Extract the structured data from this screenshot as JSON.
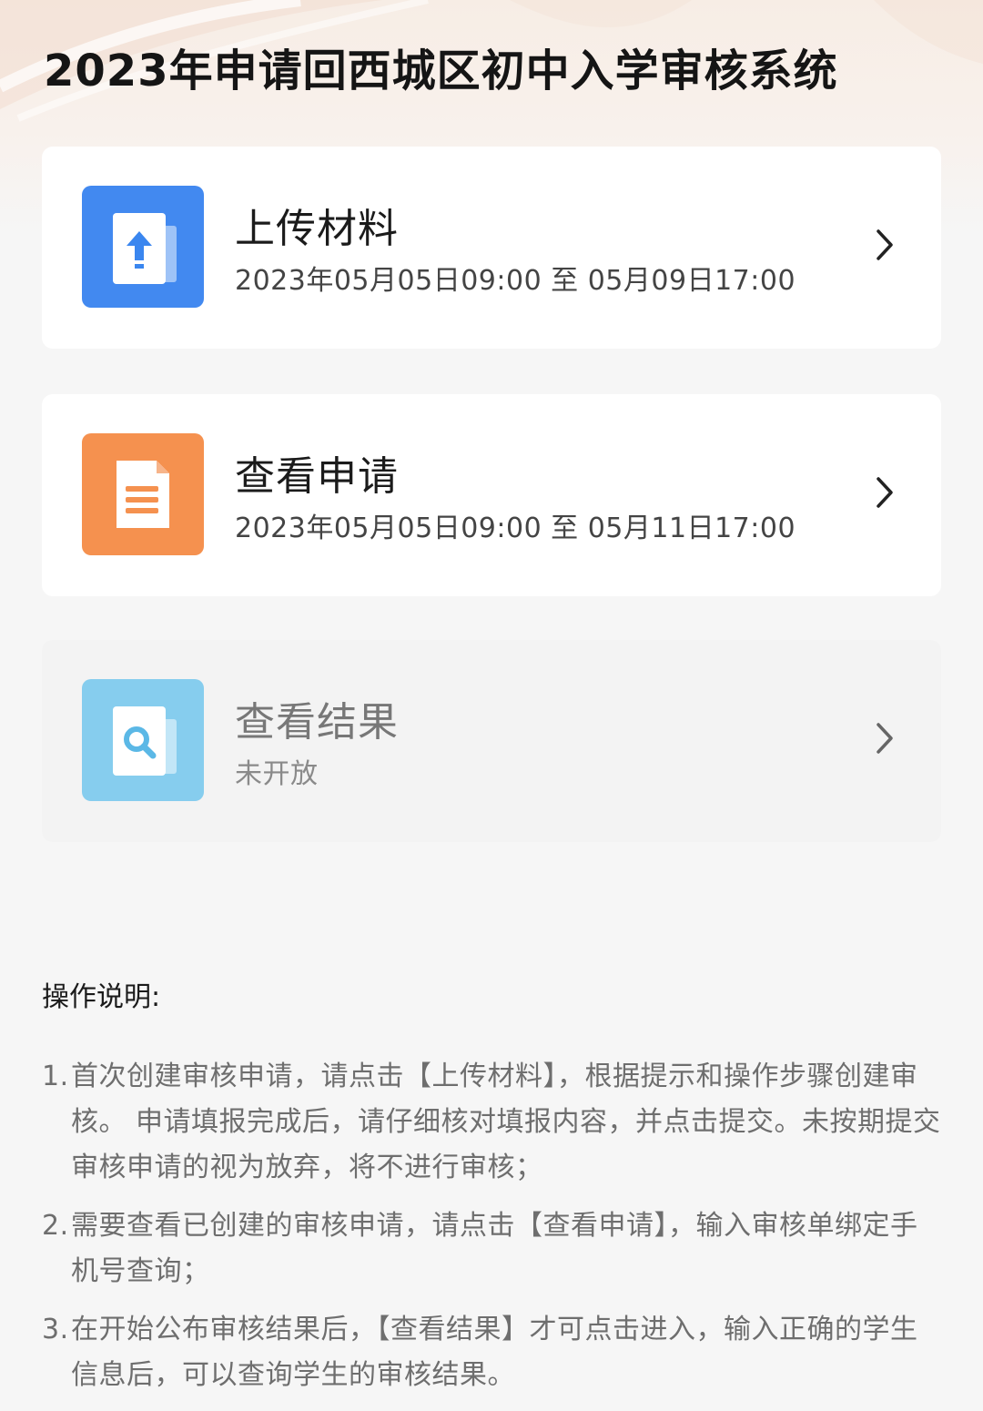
{
  "page": {
    "title": "2023年申请回西城区初中入学审核系统"
  },
  "cards": [
    {
      "title": "上传材料",
      "subtitle": "2023年05月05日09:00 至 05月09日17:00",
      "icon": "upload-document-icon",
      "icon_color": "#4289f0",
      "enabled": true
    },
    {
      "title": "查看申请",
      "subtitle": "2023年05月05日09:00 至 05月11日17:00",
      "icon": "document-list-icon",
      "icon_color": "#f5914f",
      "enabled": true
    },
    {
      "title": "查看结果",
      "subtitle": "未开放",
      "icon": "search-document-icon",
      "icon_color": "#86cdee",
      "enabled": false
    }
  ],
  "instructions": {
    "heading": "操作说明:",
    "items": [
      {
        "num": "1.",
        "text": "首次创建审核申请，请点击【上传材料】，根据提示和操作步骤创建审核。 申请填报完成后，请仔细核对填报内容，并点击提交。未按期提交审核申请的视为放弃，将不进行审核；"
      },
      {
        "num": "2.",
        "text": "需要查看已创建的审核申请，请点击【查看申请】，输入审核单绑定手机号查询；"
      },
      {
        "num": "3.",
        "text": "在开始公布审核结果后，【查看结果】才可点击进入，输入正确的学生信息后，可以查询学生的审核结果。"
      }
    ]
  }
}
